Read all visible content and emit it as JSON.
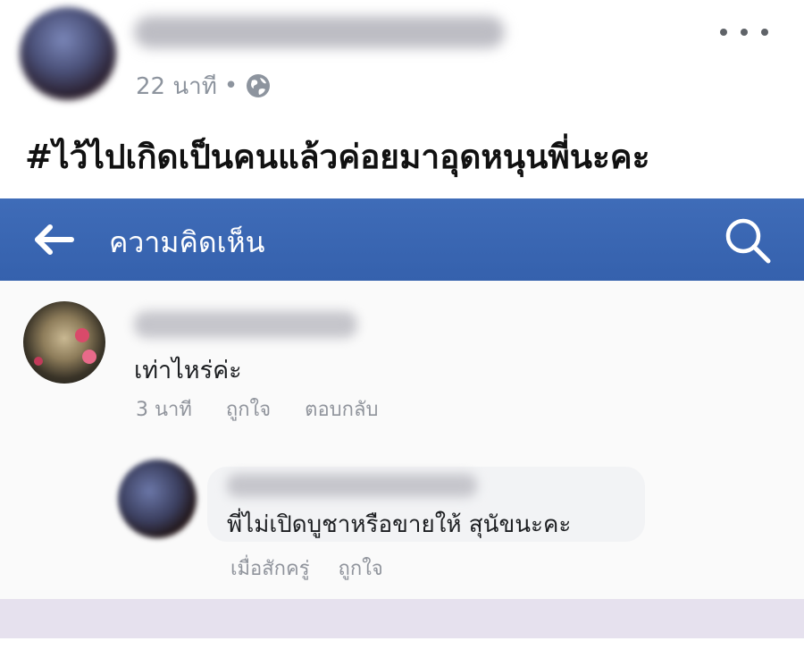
{
  "post": {
    "time": "22 นาที",
    "separator": "•",
    "text": "#ไว้ไปเกิดเป็นคนแล้วค่อยมาอุดหนุนพี่นะคะ"
  },
  "comments_bar": {
    "title": "ความคิดเห็น",
    "color": "#3a66b3"
  },
  "comments": [
    {
      "text": "เท่าไหร่ค่ะ",
      "time": "3 นาที",
      "like_label": "ถูกใจ",
      "reply_label": "ตอบกลับ"
    },
    {
      "text": "พี่ไม่เปิดบูชาหรือขายให้ สุนัขนะคะ",
      "time": "เมื่อสักครู่",
      "like_label": "ถูกใจ"
    }
  ]
}
